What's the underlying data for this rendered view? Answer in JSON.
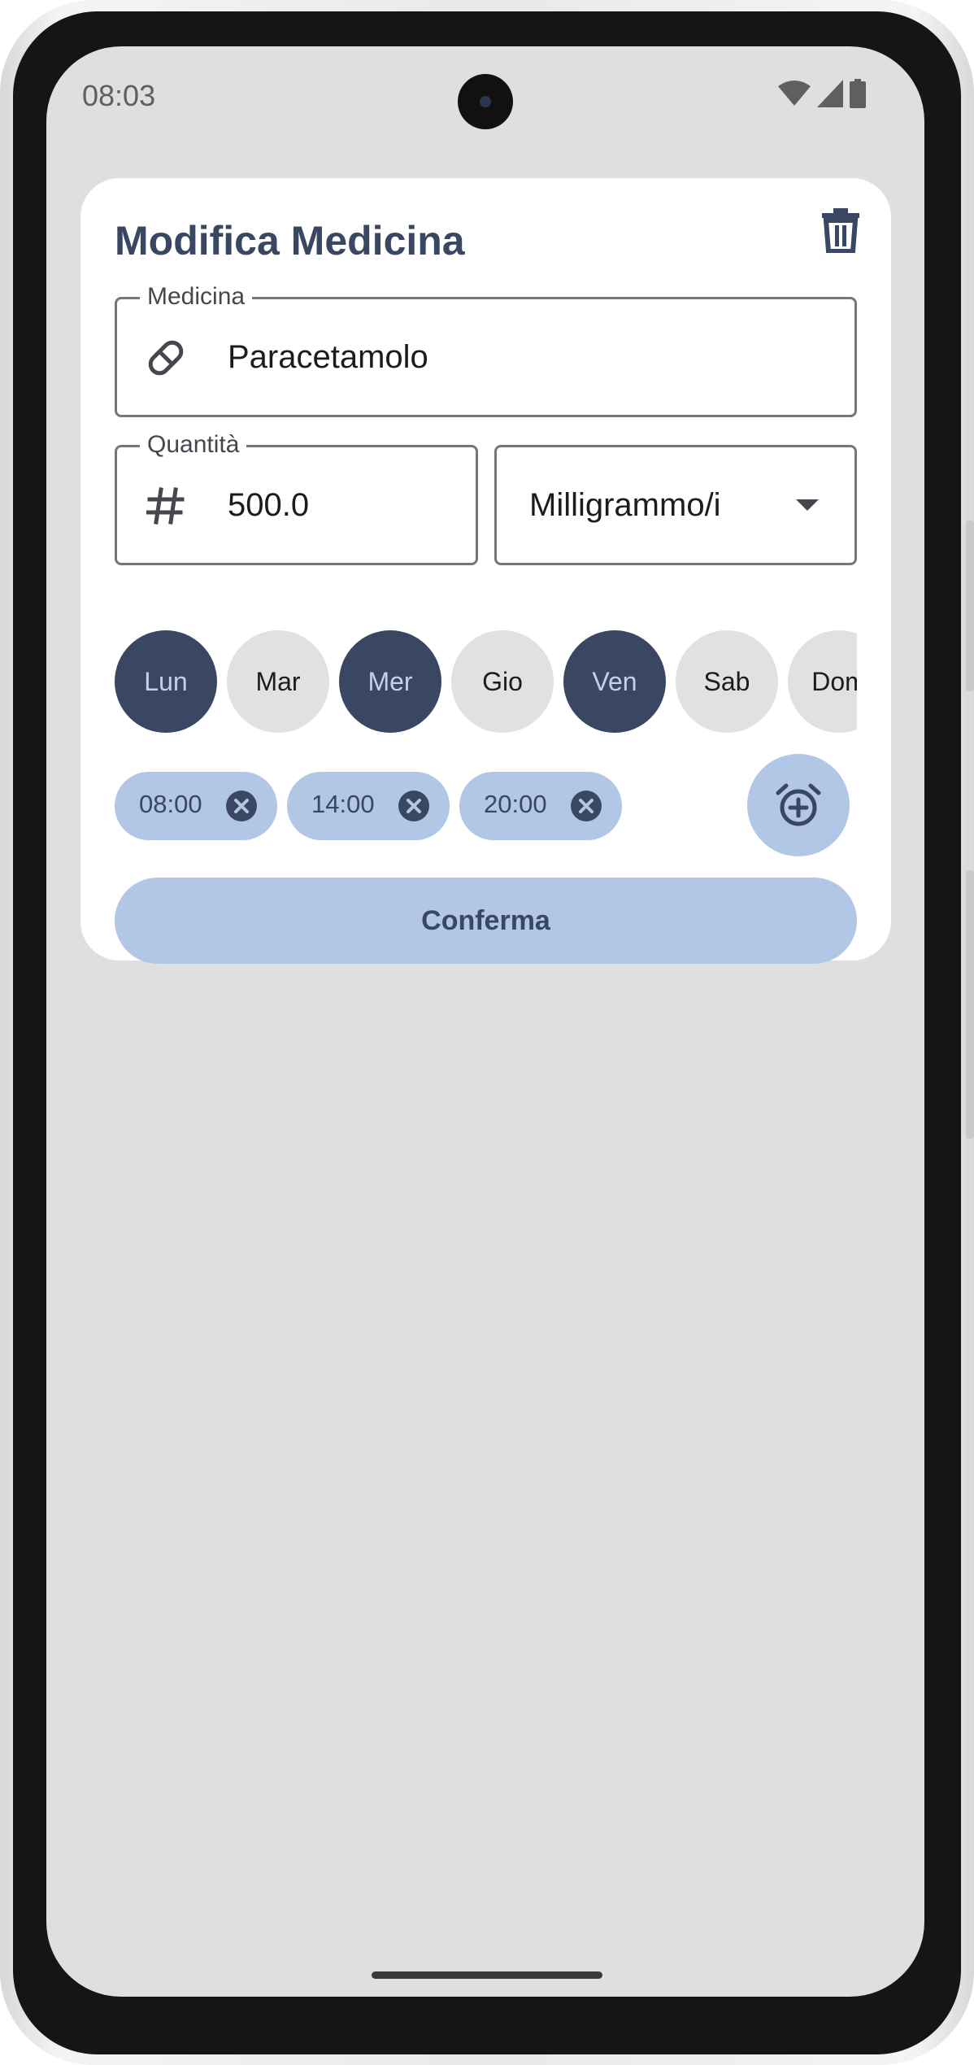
{
  "status_bar": {
    "time": "08:03",
    "icons": [
      "wifi-icon",
      "signal-icon",
      "battery-icon"
    ]
  },
  "dialog": {
    "title": "Modifica Medicina",
    "delete_icon": "trash-icon",
    "medicine_field": {
      "label": "Medicina",
      "value": "Paracetamolo",
      "icon": "pill-icon"
    },
    "quantity_field": {
      "label": "Quantità",
      "value": "500.0",
      "icon": "hash-icon"
    },
    "unit_select": {
      "value": "Milligrammo/i",
      "icon": "dropdown-arrow-icon"
    },
    "days": [
      {
        "label": "Lun",
        "selected": true
      },
      {
        "label": "Mar",
        "selected": false
      },
      {
        "label": "Mer",
        "selected": true
      },
      {
        "label": "Gio",
        "selected": false
      },
      {
        "label": "Ven",
        "selected": true
      },
      {
        "label": "Sab",
        "selected": false
      },
      {
        "label": "Dom",
        "selected": false
      }
    ],
    "times": [
      {
        "label": "08:00",
        "remove_icon": "close-circle-icon"
      },
      {
        "label": "14:00",
        "remove_icon": "close-circle-icon"
      },
      {
        "label": "20:00",
        "remove_icon": "close-circle-icon"
      }
    ],
    "add_alarm_icon": "alarm-add-icon",
    "confirm_label": "Conferma"
  },
  "colors": {
    "primary": "#3a4762",
    "primary_container": "#b2c6e6",
    "screen_background": "#dfdfdf",
    "surface": "#ffffff"
  }
}
